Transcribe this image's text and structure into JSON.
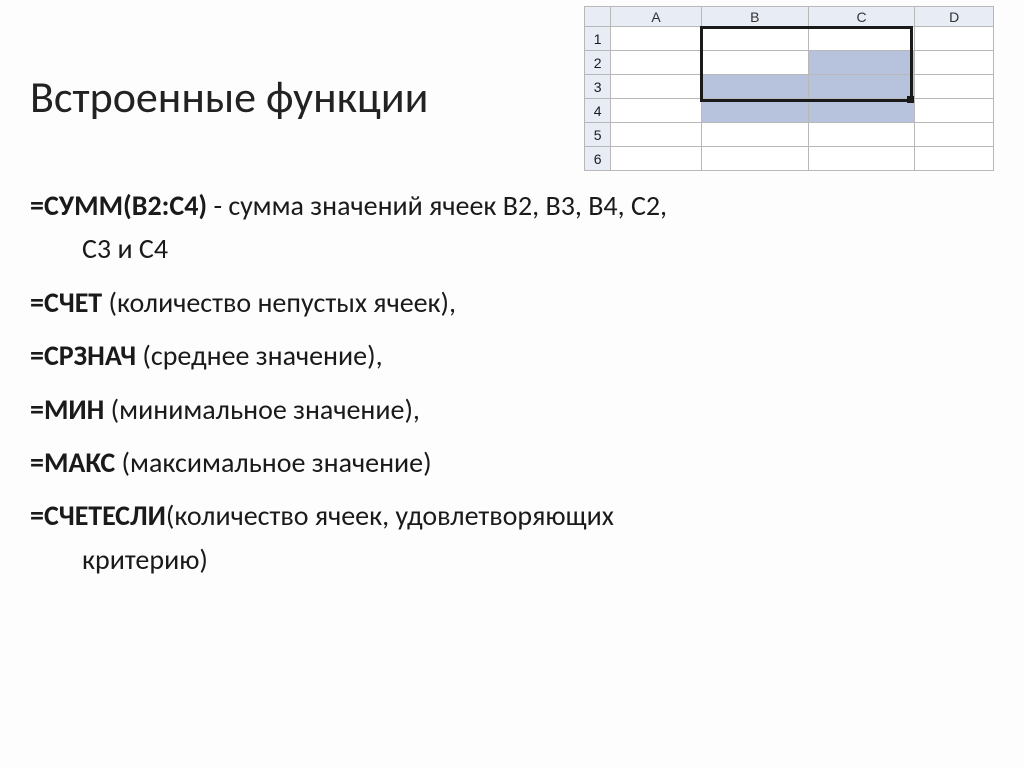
{
  "title": "Встроенные функции",
  "spreadsheet": {
    "cols": [
      "A",
      "B",
      "C",
      "D"
    ],
    "rows": [
      "1",
      "2",
      "3",
      "4",
      "5",
      "6"
    ],
    "selection_range": "B2:C4"
  },
  "items": [
    {
      "formula": "=СУММ(В2:С4)",
      "sep": "  - ",
      "desc": "сумма значений ячеек В2, В3, В4, С2, С3 и С4",
      "indent_tail": true,
      "block": true
    },
    {
      "formula": "=СЧЕТ ",
      "sep": "",
      "desc": "(количество непустых ячеек),"
    },
    {
      "formula": "=СРЗНАЧ ",
      "sep": "",
      "desc": "(среднее значение),"
    },
    {
      "formula": "=МИН ",
      "sep": "",
      "desc": "(минимальное значение),"
    },
    {
      "formula": "=МАКС ",
      "sep": "",
      "desc": "(максимальное значение)"
    },
    {
      "formula": "=СЧЕТЕСЛИ",
      "sep": "",
      "desc": "(количество ячеек, удовлетворяющих критерию)",
      "indent_tail": true
    }
  ]
}
